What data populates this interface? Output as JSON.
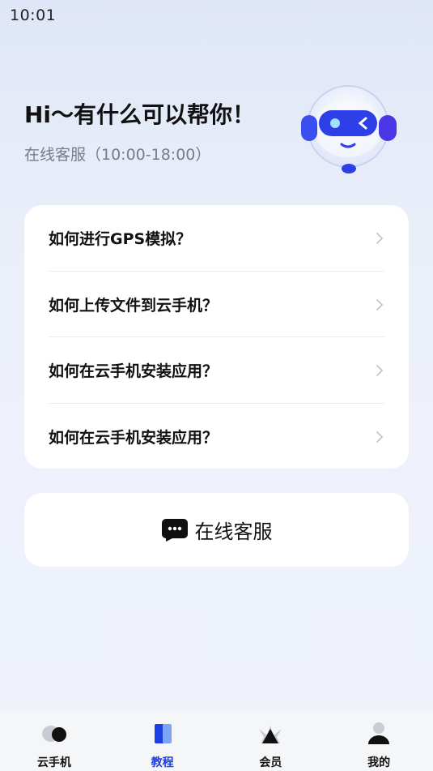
{
  "status_bar": {
    "time": "10:01"
  },
  "hero": {
    "title": "Hi～有什么可以帮你！",
    "subtitle": "在线客服（10:00-18:00）"
  },
  "faq": {
    "items": [
      {
        "label": "如何进行GPS模拟？"
      },
      {
        "label": "如何上传文件到云手机？"
      },
      {
        "label": "如何在云手机安装应用？"
      },
      {
        "label": "如何在云手机安装应用？"
      }
    ]
  },
  "customer_service": {
    "label": "在线客服",
    "icon": "chat-bubble-icon"
  },
  "bottom_nav": {
    "active_color": "#1d3fe6",
    "items": [
      {
        "label": "云手机",
        "icon": "cloud-phone-icon"
      },
      {
        "label": "教程",
        "icon": "book-icon",
        "active": true
      },
      {
        "label": "会员",
        "icon": "crown-icon"
      },
      {
        "label": "我的",
        "icon": "user-icon"
      }
    ]
  }
}
